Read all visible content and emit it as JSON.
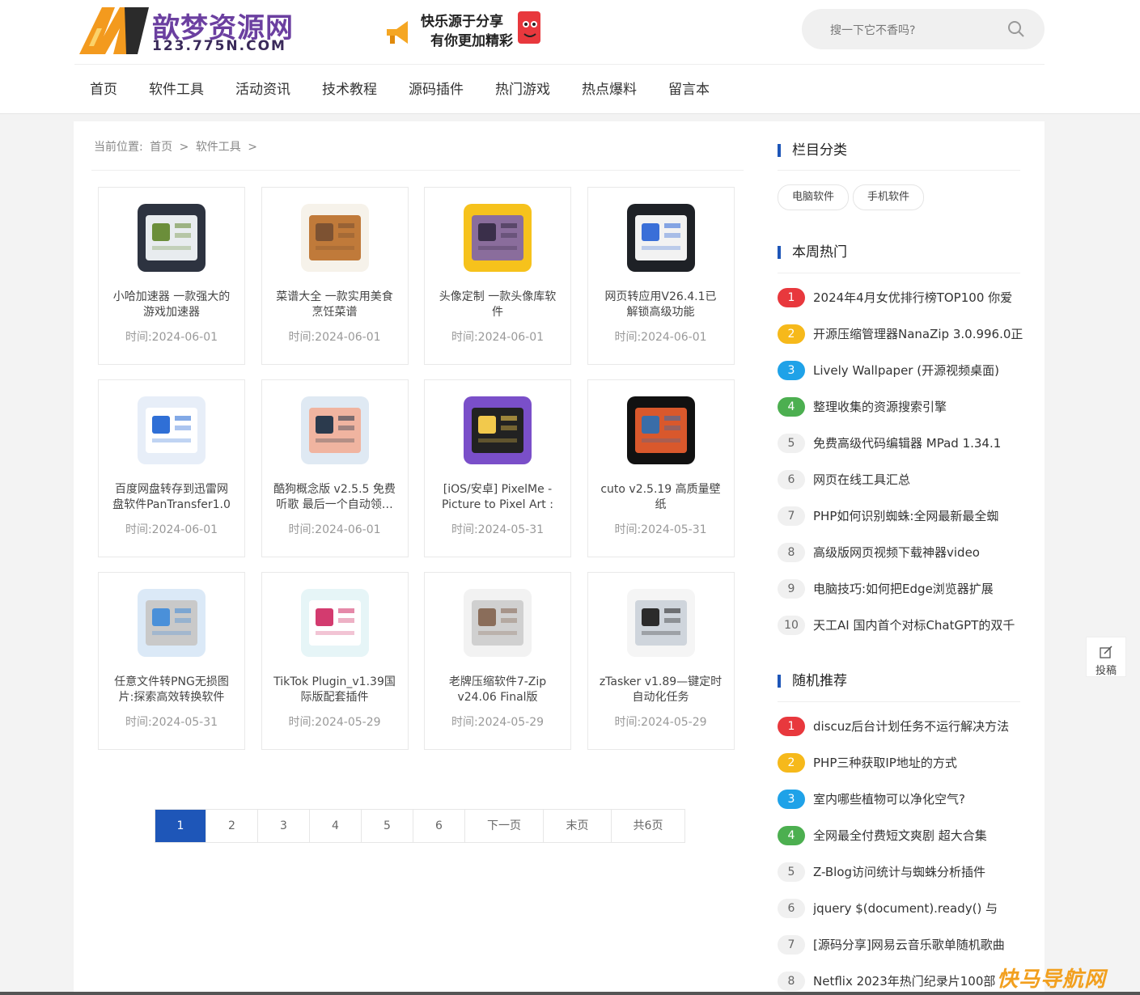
{
  "site": {
    "logo_text": "歆梦资源网",
    "logo_sub": "123.775N.COM",
    "banner_line1": "快乐源于分享",
    "banner_line2": "有你更加精彩"
  },
  "search": {
    "placeholder": "搜一下它不香吗?"
  },
  "nav": [
    "首页",
    "软件工具",
    "活动资讯",
    "技术教程",
    "源码插件",
    "热门游戏",
    "热点爆料",
    "留言本"
  ],
  "breadcrumb": {
    "prefix": "当前位置:",
    "home": "首页",
    "sep": ">",
    "current": "软件工具"
  },
  "cards": [
    {
      "title": "小哈加速器 一款强大的游戏加速器",
      "time": "时间:2024-06-01"
    },
    {
      "title": "菜谱大全 一款实用美食烹饪菜谱",
      "time": "时间:2024-06-01"
    },
    {
      "title": "头像定制 一款头像库软件",
      "time": "时间:2024-06-01"
    },
    {
      "title": "网页转应用V26.4.1已解锁高级功能",
      "time": "时间:2024-06-01"
    },
    {
      "title": "百度网盘转存到迅雷网盘软件PanTransfer1.0",
      "time": "时间:2024-06-01"
    },
    {
      "title": "酷狗概念版 v2.5.5 免费听歌 最后一个自动领…",
      "time": "时间:2024-06-01"
    },
    {
      "title": "[iOS/安卓] PixelMe - Picture to Pixel Art : …",
      "time": "时间:2024-05-31"
    },
    {
      "title": "cuto v2.5.19 高质量壁纸",
      "time": "时间:2024-05-31"
    },
    {
      "title": "任意文件转PNG无损图片:探索高效转换软件",
      "time": "时间:2024-05-31"
    },
    {
      "title": "TikTok Plugin_v1.39国际版配套插件",
      "time": "时间:2024-05-29"
    },
    {
      "title": "老牌压缩软件7-Zip v24.06 Final版",
      "time": "时间:2024-05-29"
    },
    {
      "title": "zTasker v1.89—键定时自动化任务",
      "time": "时间:2024-05-29"
    }
  ],
  "pagination": [
    "1",
    "2",
    "3",
    "4",
    "5",
    "6",
    "下一页",
    "末页",
    "共6页"
  ],
  "pagination_active": "1",
  "sidebar": {
    "category_title": "栏目分类",
    "categories": [
      "电脑软件",
      "手机软件"
    ],
    "hot_title": "本周热门",
    "hot": [
      {
        "num": "1",
        "text": "2024年4月女优排行榜TOP100 你爱"
      },
      {
        "num": "2",
        "text": "开源压缩管理器NanaZip 3.0.996.0正"
      },
      {
        "num": "3",
        "text": "Lively Wallpaper (开源视频桌面)"
      },
      {
        "num": "4",
        "text": "整理收集的资源搜索引擎"
      },
      {
        "num": "5",
        "text": "免费高级代码编辑器 MPad 1.34.1"
      },
      {
        "num": "6",
        "text": "网页在线工具汇总"
      },
      {
        "num": "7",
        "text": "PHP如何识别蜘蛛:全网最新最全蜘"
      },
      {
        "num": "8",
        "text": "高级版网页视频下载神器video"
      },
      {
        "num": "9",
        "text": "电脑技巧:如何把Edge浏览器扩展"
      },
      {
        "num": "10",
        "text": "天工AI 国内首个对标ChatGPT的双千"
      }
    ],
    "random_title": "随机推荐",
    "random": [
      {
        "num": "1",
        "text": "discuz后台计划任务不运行解决方法"
      },
      {
        "num": "2",
        "text": "PHP三种获取IP地址的方式"
      },
      {
        "num": "3",
        "text": "室内哪些植物可以净化空气?"
      },
      {
        "num": "4",
        "text": "全网最全付费短文爽剧 超大合集"
      },
      {
        "num": "5",
        "text": "Z-Blog访问统计与蜘蛛分析插件"
      },
      {
        "num": "6",
        "text": "jquery $(document).ready() 与"
      },
      {
        "num": "7",
        "text": "[源码分享]网易云音乐歌单随机歌曲"
      },
      {
        "num": "8",
        "text": "Netflix 2023年热门纪录片100部"
      }
    ]
  },
  "float_button": {
    "label": "投稿"
  },
  "watermark": "快马导航网",
  "colors": {
    "accent": "#1e56b8",
    "rank1": "#e8383d",
    "rank2": "#f6b91b",
    "rank3": "#1fa2e8",
    "rank4": "#4caf50"
  }
}
